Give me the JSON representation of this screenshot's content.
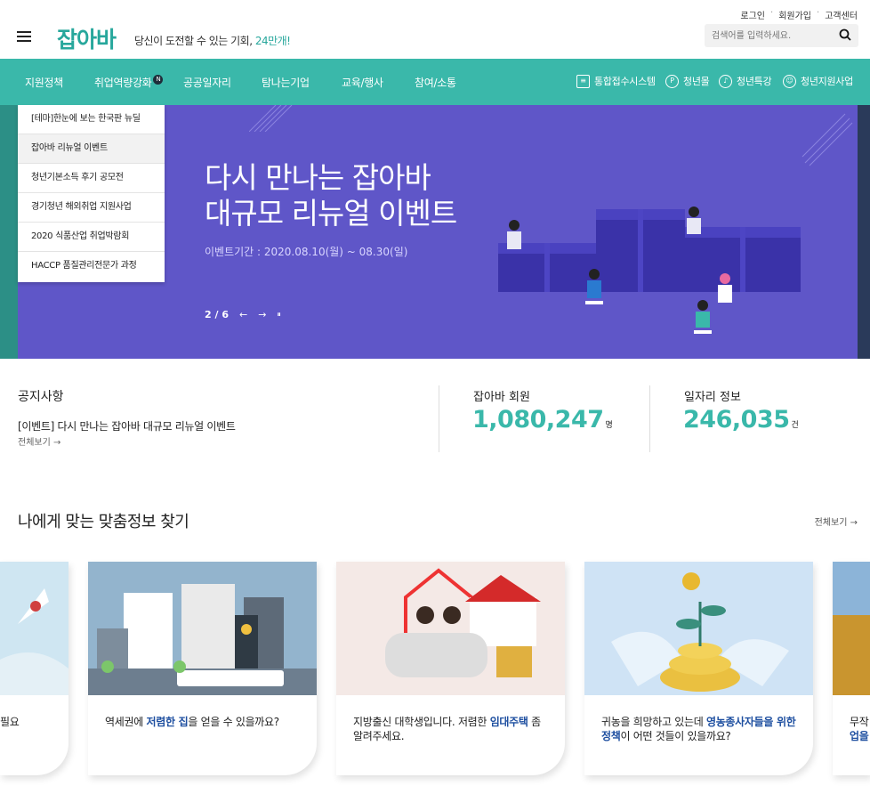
{
  "util_links": [
    "로그인",
    "회원가입",
    "고객센터"
  ],
  "logo": "잡아바",
  "slogan": {
    "text": "당신이 도전할 수 있는 기회, ",
    "highlight": "24만개!"
  },
  "search": {
    "placeholder": "검색어를 입력하세요."
  },
  "nav": {
    "items": [
      "지원정책",
      "취업역량강화",
      "공공일자리",
      "탐나는기업",
      "교육/행사",
      "참여/소통"
    ],
    "badge": "N",
    "right": [
      "통합접수시스템",
      "청년몰",
      "청년특강",
      "청년지원사업"
    ]
  },
  "dropdown": [
    "[테마]한눈에 보는 한국판 뉴딜",
    "잡아바 리뉴얼 이벤트",
    "청년기본소득 후기 공모전",
    "경기청년 해외취업 지원사업",
    "2020 식품산업 취업박람회",
    "HACCP 품질관리전문가 과정"
  ],
  "banner": {
    "line1": "다시 만나는 잡아바",
    "line2": "대규모 리뉴얼 이벤트",
    "period": "이벤트기간 : 2020.08.10(월) ~ 08.30(일)",
    "page": "2 / 6",
    "prev": "←",
    "next": "→",
    "pause": "⏸"
  },
  "notice": {
    "title": "공지사항",
    "text": "[이벤트] 다시 만나는 잡아바 대규모 리뉴얼 이벤트",
    "more": "전체보기 →"
  },
  "stats": [
    {
      "label": "잡아바 회원",
      "value": "1,080,247",
      "unit": "명"
    },
    {
      "label": "일자리 정보",
      "value": "246,035",
      "unit": "건"
    }
  ],
  "custom": {
    "title": "나에게 맞는 맞춤정보 찾기",
    "more": "전체보기 →",
    "cards": [
      {
        "pre": "필요",
        "hl": "",
        "post": ""
      },
      {
        "pre": "역세권에 ",
        "hl": "저렴한 집",
        "post": "을 얻을 수 있을까요?"
      },
      {
        "pre": "지방출신 대학생입니다. 저렴한 ",
        "hl": "임대주택",
        "post": " 좀 알려주세요."
      },
      {
        "pre": "귀농을 희망하고 있는데 ",
        "hl": "영농종사자들을 위한 정책",
        "post": "이 어떤 것들이 있을까요?"
      },
      {
        "pre": "무작",
        "hl": "업을",
        "post": ""
      }
    ]
  },
  "colors": {
    "primary": "#3ab8aa",
    "banner": "#5f56c8",
    "highlight": "#1e4fa0"
  }
}
